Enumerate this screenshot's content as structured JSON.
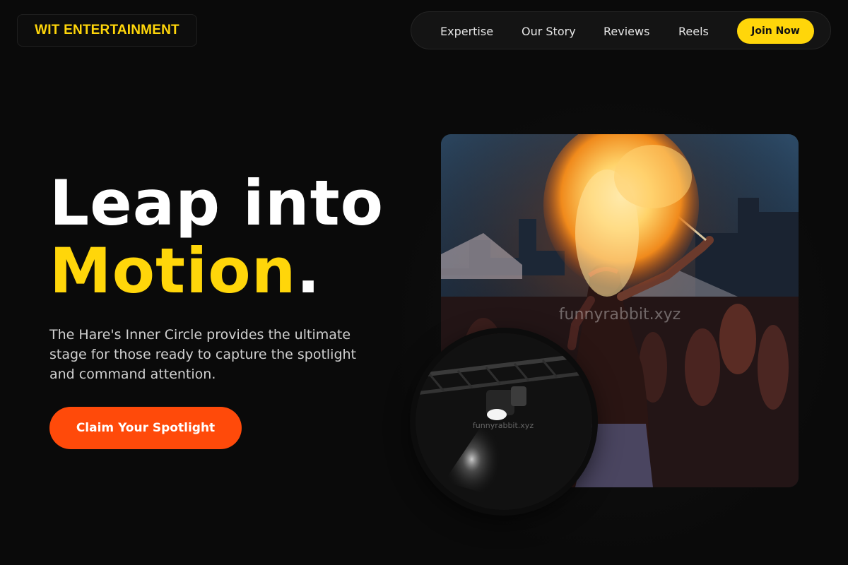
{
  "header": {
    "logo": "WIT ENTERTAINMENT",
    "nav": [
      {
        "label": "Expertise"
      },
      {
        "label": "Our Story"
      },
      {
        "label": "Reviews"
      },
      {
        "label": "Reels"
      }
    ],
    "join_label": "Join Now"
  },
  "hero": {
    "title_line1": "Leap into",
    "title_highlight": "Motion",
    "title_punct": ".",
    "description": "The Hare's Inner Circle provides the ultimate stage for those ready to capture the spotlight and command attention.",
    "cta_label": "Claim Your Spotlight"
  },
  "media": {
    "main_watermark": "funnyrabbit.xyz",
    "spot_watermark": "funnyrabbit.xyz"
  },
  "colors": {
    "background": "#0a0a0a",
    "accent_yellow": "#ffd60a",
    "accent_orange": "#ff4a0a"
  }
}
